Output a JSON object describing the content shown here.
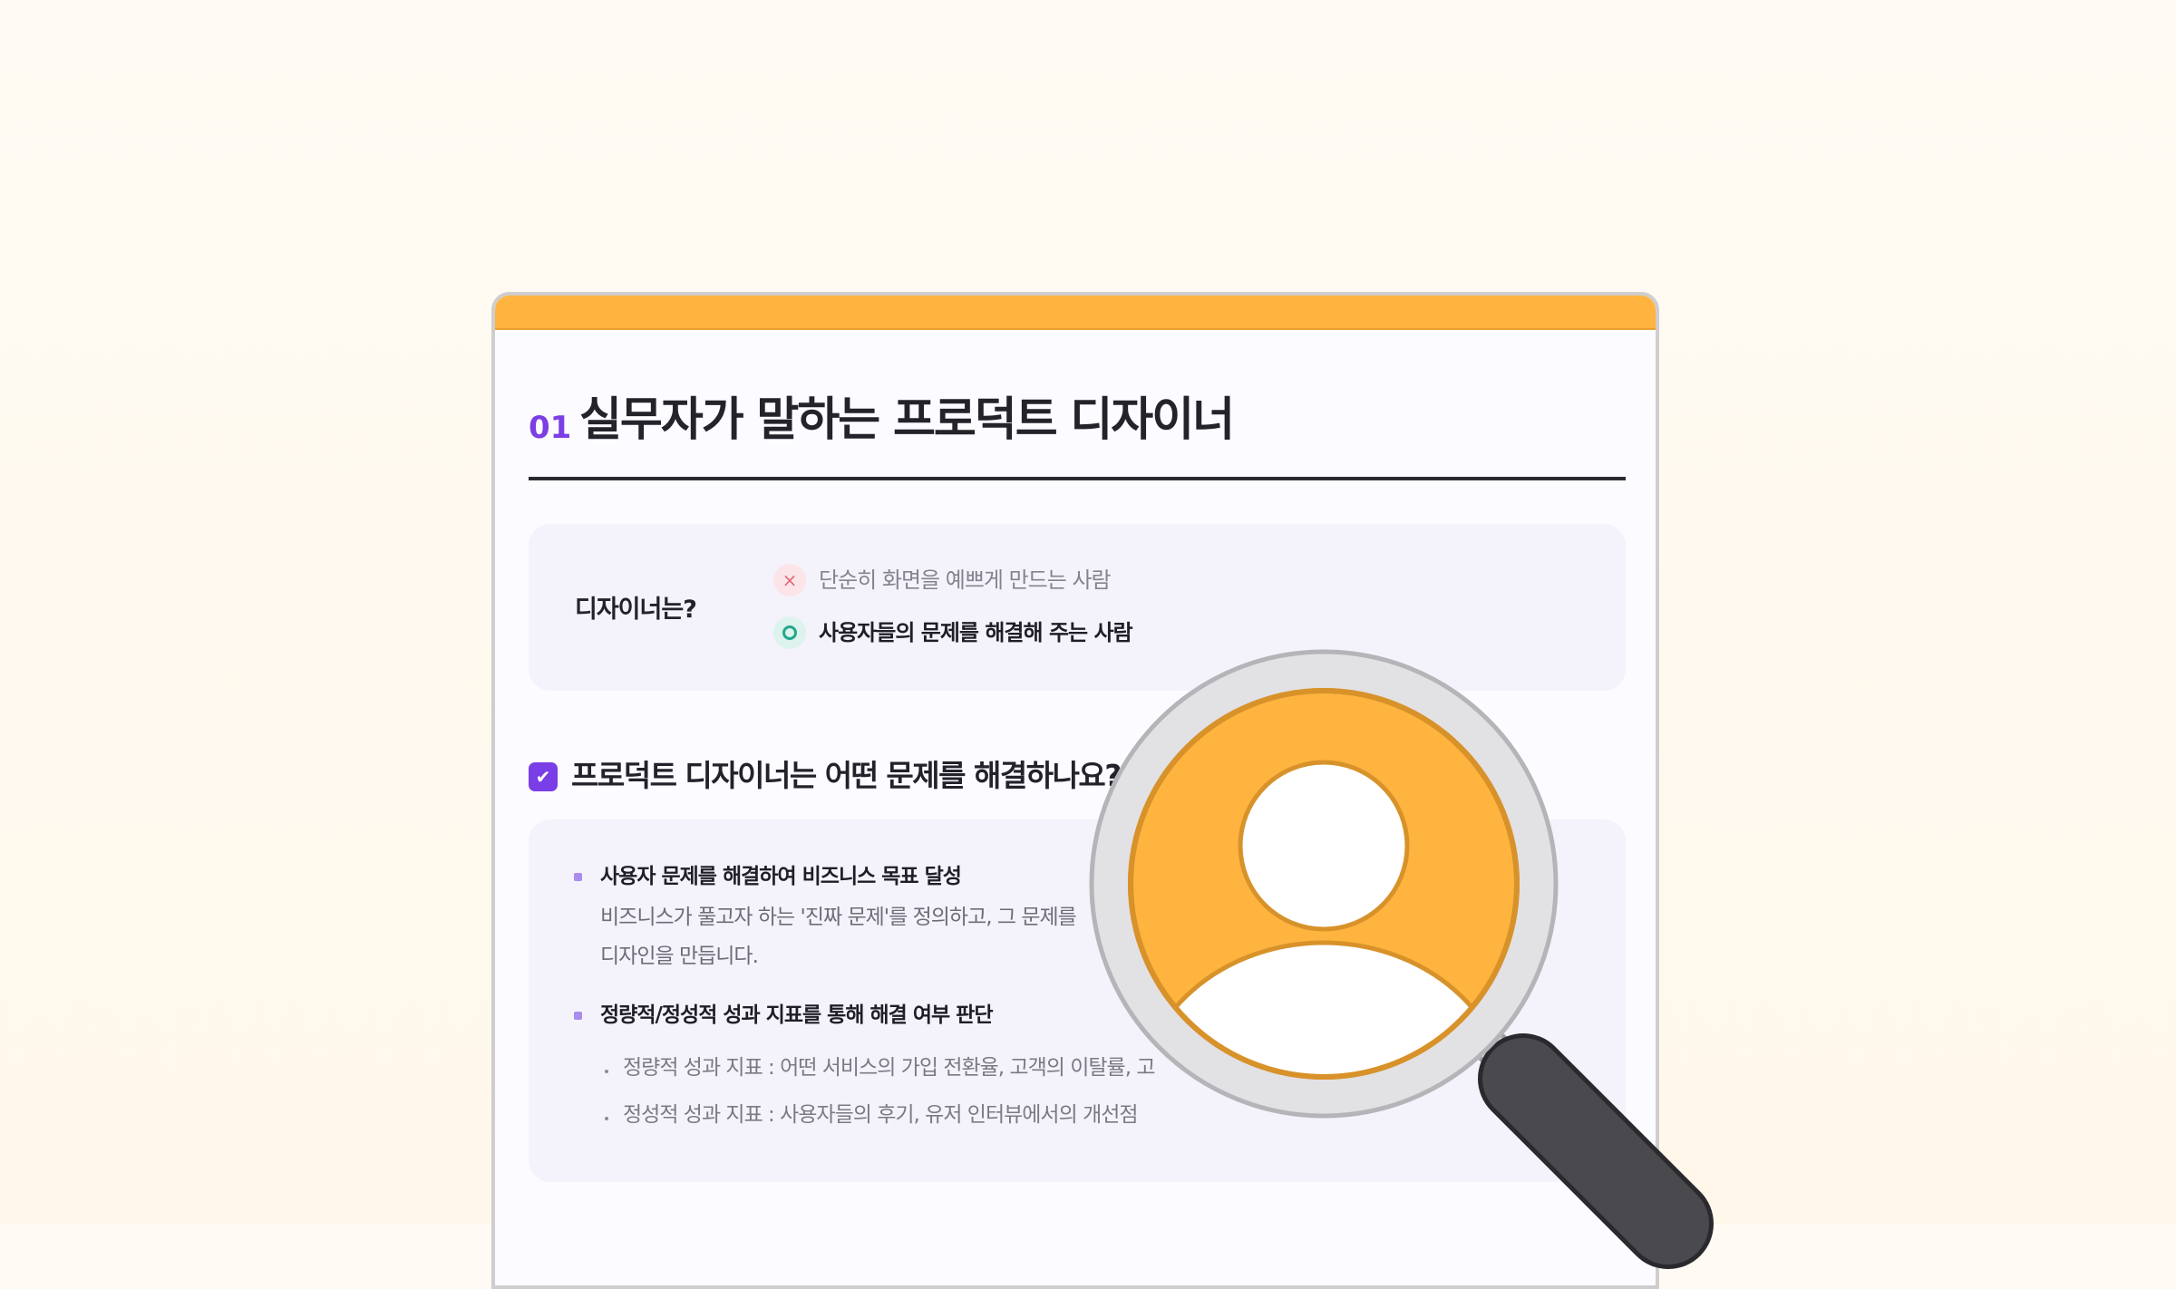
{
  "section": {
    "number": "01",
    "title": "실무자가 말하는 프로덕트 디자이너"
  },
  "definition": {
    "label": "디자이너는?",
    "wrong": {
      "mark": "×",
      "text": "단순히 화면을 예쁘게 만드는 사람"
    },
    "right": {
      "text": "사용자들의 문제를 해결해 주는 사람"
    }
  },
  "question": {
    "check_mark": "✔",
    "text": "프로덕트 디자이너는 어떤 문제를 해결하나요?"
  },
  "points": [
    {
      "title": "사용자 문제를 해결하여 비즈니스 목표 달성",
      "desc_line1": "비즈니스가 풀고자 하는 '진짜 문제'를 정의하고, 그 문제를",
      "desc_line2": "디자인을 만듭니다."
    },
    {
      "title": "정량적/정성적 성과 지표를 통해 해결 여부 판단",
      "subs": [
        "정량적 성과 지표 : 어떤 서비스의 가입 전환율, 고객의 이탈률, 고",
        "정성적 성과 지표 : 사용자들의 후기, 유저 인터뷰에서의 개선점"
      ]
    }
  ],
  "colors": {
    "accent_orange": "#ffb43f",
    "accent_purple": "#7a3ee6",
    "handle_dark": "#4a494e"
  },
  "icons": {
    "magnifier": "magnifier-user-icon"
  }
}
